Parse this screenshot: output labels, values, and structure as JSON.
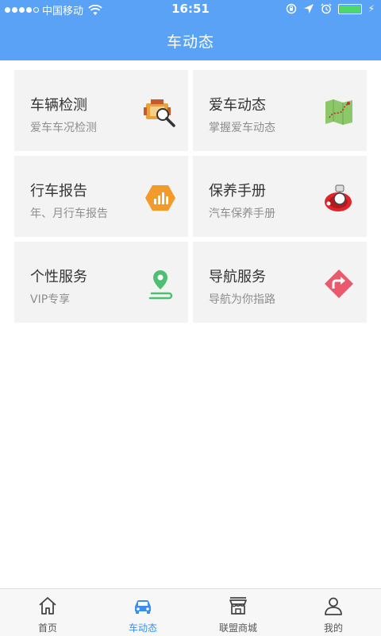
{
  "status_bar": {
    "carrier": "中国移动",
    "time": "16:51"
  },
  "header": {
    "title": "车动态"
  },
  "cards": [
    {
      "title": "车辆检测",
      "subtitle": "爱车车况检测",
      "icon": "engine-inspect-icon"
    },
    {
      "title": "爱车动态",
      "subtitle": "掌握爱车动态",
      "icon": "map-route-icon"
    },
    {
      "title": "行车报告",
      "subtitle": "年、月行车报告",
      "icon": "report-chart-icon"
    },
    {
      "title": "保养手册",
      "subtitle": "汽车保养手册",
      "icon": "maintenance-icon"
    },
    {
      "title": "个性服务",
      "subtitle": "VIP专享",
      "icon": "location-pin-icon"
    },
    {
      "title": "导航服务",
      "subtitle": "导航为你指路",
      "icon": "navigation-sign-icon"
    }
  ],
  "tabbar": {
    "active_color": "#3a8ef0",
    "items": [
      {
        "label": "首页",
        "icon": "home-icon"
      },
      {
        "label": "车动态",
        "icon": "car-icon"
      },
      {
        "label": "联盟商城",
        "icon": "shop-icon"
      },
      {
        "label": "我的",
        "icon": "user-icon"
      }
    ]
  }
}
